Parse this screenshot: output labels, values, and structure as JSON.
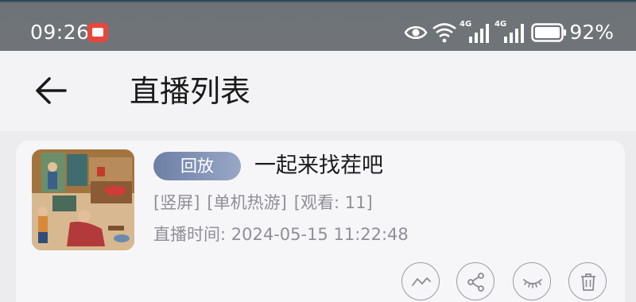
{
  "status_bar": {
    "time": "09:26",
    "battery": "92%",
    "icons": [
      "notification-book-icon",
      "eye-icon",
      "wifi-icon",
      "signal-4g-icon",
      "signal-4g-icon",
      "battery-icon"
    ],
    "network_label_1": "4G",
    "network_label_2": "4G"
  },
  "app_bar": {
    "title": "直播列表",
    "back_icon": "arrow-left-icon"
  },
  "live_list": [
    {
      "badge": "回放",
      "title": "一起来找茬吧",
      "tags": [
        "[竖屏]",
        "[单机热游]",
        "[观看: 11]"
      ],
      "time": "直播时间: 2024-05-15 11:22:48",
      "actions": [
        "trend-icon",
        "share-icon",
        "eye-closed-icon",
        "trash-icon"
      ]
    }
  ],
  "colors": {
    "status_bar_bg": "#707478",
    "badge_start": "#6e7fa6",
    "badge_end": "#98a7c6",
    "secondary_text": "#8f8f95"
  }
}
